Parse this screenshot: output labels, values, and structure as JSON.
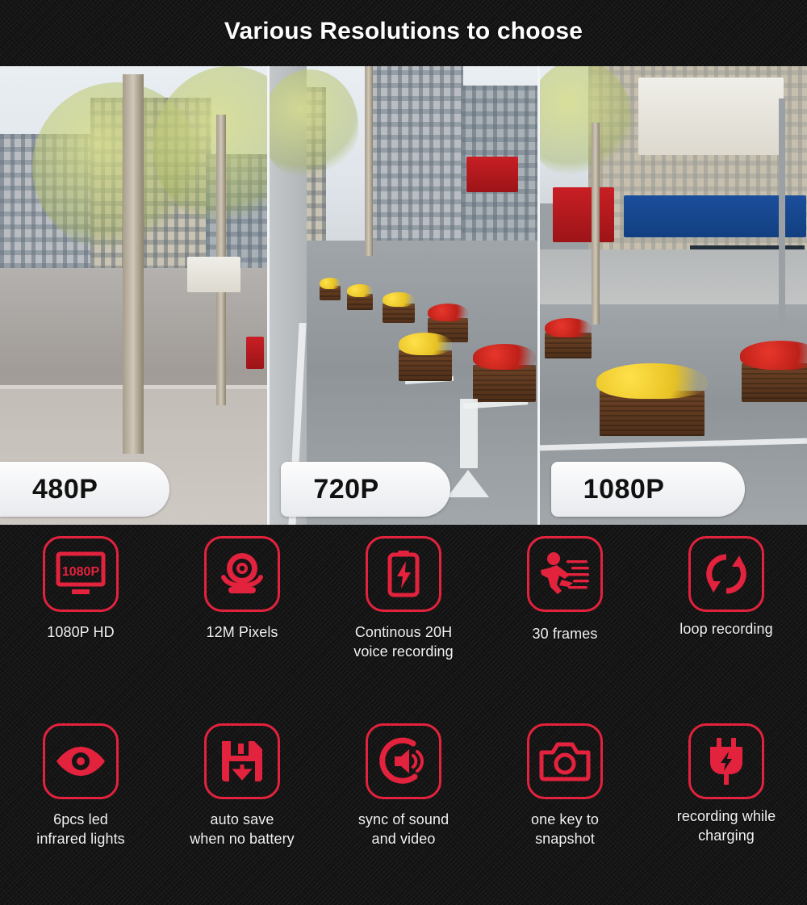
{
  "header": {
    "title": "Various Resolutions to choose"
  },
  "colors": {
    "accent_red": "#e3223d",
    "background_dark": "#121212",
    "text_light": "#f2f2f2",
    "banner_white": "#fdfdfd"
  },
  "photo_strip": {
    "panels": [
      {
        "resolution_label": "480P",
        "scene": "city street with trees, sidewalk and buildings — lowest sharpness",
        "quality": "low"
      },
      {
        "resolution_label": "720P",
        "scene": "city street with flower planters, lane markings and road arrow — medium sharpness",
        "quality": "medium"
      },
      {
        "resolution_label": "1080P",
        "scene": "city street with shopfront signage, yellow and red flower planters — highest sharpness",
        "quality": "high"
      }
    ]
  },
  "features": {
    "rows": [
      {
        "items": [
          {
            "icon": "monitor-1080p-icon",
            "icon_text": "1080P",
            "label": "1080P HD"
          },
          {
            "icon": "webcam-icon",
            "label": "12M Pixels"
          },
          {
            "icon": "battery-bolt-icon",
            "label": "Continous 20H\nvoice recording"
          },
          {
            "icon": "running-person-icon",
            "label": "30 frames"
          },
          {
            "icon": "loop-arrows-icon",
            "label": "loop recording"
          }
        ]
      },
      {
        "items": [
          {
            "icon": "eye-icon",
            "label": "6pcs led\ninfrared lights"
          },
          {
            "icon": "floppy-save-icon",
            "label": "auto save\nwhen no battery"
          },
          {
            "icon": "speaker-sound-icon",
            "label": "sync of sound\nand video"
          },
          {
            "icon": "camera-icon",
            "label": "one key to\nsnapshot"
          },
          {
            "icon": "power-plug-bolt-icon",
            "label": "recording while\ncharging"
          }
        ]
      }
    ]
  }
}
